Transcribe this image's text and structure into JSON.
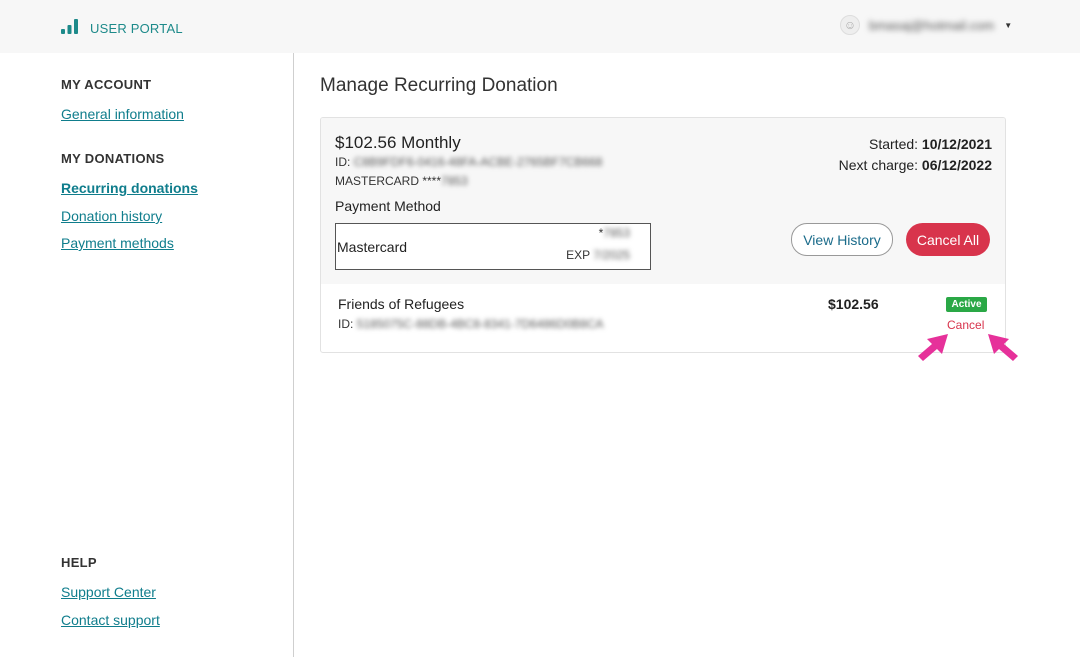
{
  "header": {
    "brand_label": "USER PORTAL",
    "brand_icon": "signal-bars-icon",
    "user_email": "bmasaj@hotmail.com",
    "accent_color": "#1d8a8a"
  },
  "sidebar": {
    "sections": [
      {
        "heading": "MY ACCOUNT",
        "links": [
          "General information"
        ]
      },
      {
        "heading": "MY DONATIONS",
        "links": [
          "Recurring donations",
          "Donation history",
          "Payment methods"
        ]
      },
      {
        "heading": "HELP",
        "links": [
          "Support Center",
          "Contact support"
        ]
      }
    ],
    "active_link": "Recurring donations"
  },
  "main": {
    "title": "Manage Recurring Donation",
    "donation": {
      "amount_title": "$102.56 Monthly",
      "id_label": "ID:",
      "id_value": "C8B9FDF6-0416-48FA-ACBE-2765BF7CB668",
      "card_prefix": "MASTERCARD ****",
      "card_last4": "7853",
      "started_label": "Started:",
      "started_value": "10/12/2021",
      "next_label": "Next charge:",
      "next_value": "06/12/2022",
      "payment_method_label": "Payment Method",
      "payment_method": {
        "brand": "Mastercard",
        "last4_prefix": "*",
        "last4": "7853",
        "exp_label": "EXP",
        "exp_value": "7/2025"
      },
      "view_history_label": "View History",
      "cancel_all_label": "Cancel All",
      "cancel_all_color": "#d8344c",
      "item": {
        "name": "Friends of Refugees",
        "id_label": "ID:",
        "id_value": "5185075C-88DB-4BC8-8341-7D6486D0B8CA",
        "amount": "$102.56",
        "status": "Active",
        "status_color": "#2aa846",
        "cancel_label": "Cancel"
      }
    }
  }
}
